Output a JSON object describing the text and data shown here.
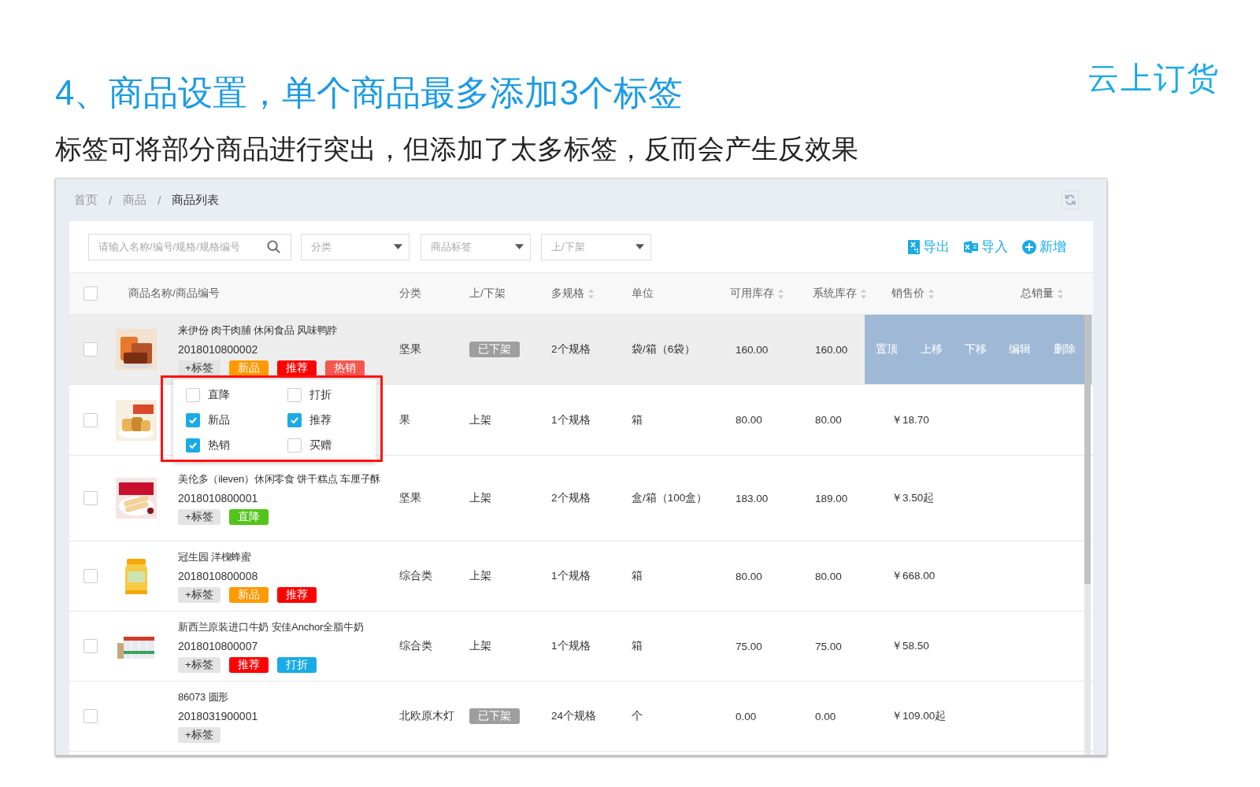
{
  "slide": {
    "title": "4、商品设置，单个商品最多添加3个标签",
    "subtitle": "标签可将部分商品进行突出，但添加了太多标签，反而会产生反效果",
    "logo": "云上订货"
  },
  "breadcrumb": {
    "separator": "/",
    "items": [
      {
        "label": "首页",
        "current": false
      },
      {
        "label": "商品",
        "current": false
      },
      {
        "label": "商品列表",
        "current": true
      }
    ]
  },
  "toolbar": {
    "search": {
      "placeholder": "请输入名称/编号/规格/规格编号"
    },
    "filters": [
      {
        "placeholder": "分类"
      },
      {
        "placeholder": "商品标签"
      },
      {
        "placeholder": "上/下架"
      }
    ],
    "actions": [
      {
        "kind": "export",
        "label": "导出"
      },
      {
        "kind": "import",
        "label": "导入"
      },
      {
        "kind": "add",
        "label": "新增"
      }
    ]
  },
  "table": {
    "select_all_checked": false,
    "columns": [
      {
        "label": "商品名称/商品编号",
        "sortable": false
      },
      {
        "label": "分类",
        "sortable": false
      },
      {
        "label": "上/下架",
        "sortable": false
      },
      {
        "label": "多规格",
        "sortable": true
      },
      {
        "label": "单位",
        "sortable": false
      },
      {
        "label": "可用库存",
        "sortable": true
      },
      {
        "label": "系统库存",
        "sortable": true
      },
      {
        "label": "销售价",
        "sortable": true
      },
      {
        "label": "总销量",
        "sortable": true
      }
    ],
    "rows": [
      {
        "checked": false,
        "hovered": true,
        "image": {
          "kind": "picture"
        },
        "name": "来伊份 肉干肉脯 休闲食品 风味鸭脖",
        "code": "2018010800002",
        "add_tag": "+标签",
        "tags": [
          {
            "label": "新品",
            "color": "#ff9900"
          },
          {
            "label": "推荐",
            "color": "#ff0000"
          },
          {
            "label": "热销",
            "color": "#f5574f"
          }
        ],
        "category": "坚果",
        "status": "已下架",
        "listed": false,
        "specs": "2个规格",
        "unit": "袋/箱（6袋）",
        "available": "160.00",
        "system": "160.00",
        "actions": [
          "置顶",
          "上移",
          "下移",
          "编辑",
          "删除"
        ]
      },
      {
        "checked": false,
        "hovered": false,
        "image": {
          "kind": "picture"
        },
        "category": "果",
        "status": "上架",
        "listed": true,
        "specs": "1个规格",
        "unit": "箱",
        "available": "80.00",
        "system": "80.00",
        "price": "￥18.70"
      },
      {
        "checked": false,
        "hovered": false,
        "image": {
          "kind": "picture"
        },
        "name": "美伦多（ileven）休闲零食 饼干糕点 车厘子酥",
        "code": "2018010800001",
        "add_tag": "+标签",
        "tags": [
          {
            "label": "直降",
            "color": "#52c41a"
          }
        ],
        "category": "坚果",
        "status": "上架",
        "listed": true,
        "specs": "2个规格",
        "unit": "盒/箱（100盒）",
        "available": "183.00",
        "system": "189.00",
        "price": "￥3.50起"
      },
      {
        "checked": false,
        "hovered": false,
        "image": {
          "kind": "picture"
        },
        "name": "冠生园 洋槐蜂蜜",
        "code": "2018010800008",
        "add_tag": "+标签",
        "tags": [
          {
            "label": "新品",
            "color": "#ff9900"
          },
          {
            "label": "推荐",
            "color": "#ff0000"
          }
        ],
        "category": "综合类",
        "status": "上架",
        "listed": true,
        "specs": "1个规格",
        "unit": "箱",
        "available": "80.00",
        "system": "80.00",
        "price": "￥668.00"
      },
      {
        "checked": false,
        "hovered": false,
        "image": {
          "kind": "picture"
        },
        "name": "新西兰原装进口牛奶 安佳Anchor全脂牛奶",
        "code": "2018010800007",
        "add_tag": "+标签",
        "tags": [
          {
            "label": "推荐",
            "color": "#ff0000"
          },
          {
            "label": "打折",
            "color": "#1aabe6"
          }
        ],
        "category": "综合类",
        "status": "上架",
        "listed": true,
        "specs": "1个规格",
        "unit": "箱",
        "available": "75.00",
        "system": "75.00",
        "price": "￥58.50"
      },
      {
        "checked": false,
        "hovered": false,
        "name": "86073 圆形",
        "code": "2018031900001",
        "add_tag": "+标签",
        "tags": [],
        "category": "北欧原木灯",
        "status": "已下架",
        "listed": false,
        "specs": "24个规格",
        "unit": "个",
        "available": "0.00",
        "system": "0.00",
        "price": "￥109.00起"
      }
    ]
  },
  "tag_menu": {
    "options": [
      {
        "label": "直降",
        "checked": false
      },
      {
        "label": "打折",
        "checked": false
      },
      {
        "label": "新品",
        "checked": true
      },
      {
        "label": "推荐",
        "checked": true
      },
      {
        "label": "热销",
        "checked": true
      },
      {
        "label": "买赠",
        "checked": false
      }
    ]
  }
}
